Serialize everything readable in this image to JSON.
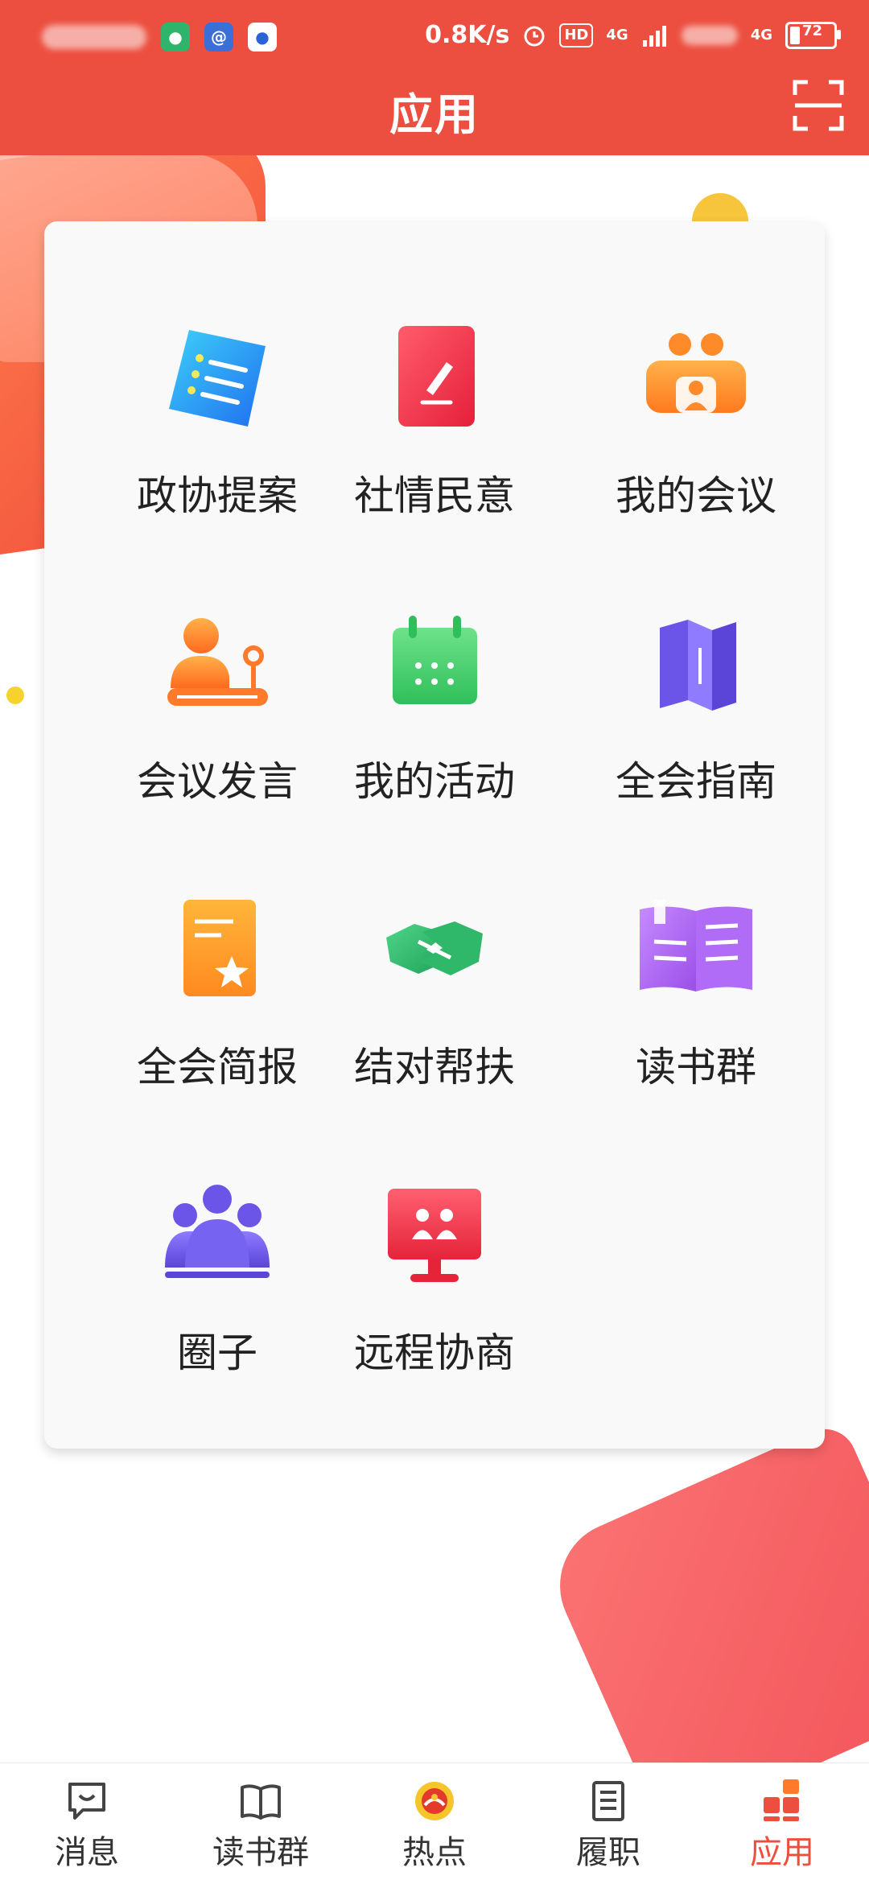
{
  "status_bar": {
    "net_speed": "0.8K/s",
    "hd_label": "HD",
    "signal1_label": "4G",
    "signal2_label": "4G",
    "battery_level": "72"
  },
  "header": {
    "title": "应用"
  },
  "apps": [
    {
      "label": "政协提案",
      "icon": "document-list-icon"
    },
    {
      "label": "社情民意",
      "icon": "edit-note-icon"
    },
    {
      "label": "我的会议",
      "icon": "meeting-icon"
    },
    {
      "label": "会议发言",
      "icon": "speaker-microphone-icon"
    },
    {
      "label": "我的活动",
      "icon": "calendar-icon"
    },
    {
      "label": "全会指南",
      "icon": "map-guide-icon"
    },
    {
      "label": "全会简报",
      "icon": "brief-star-icon"
    },
    {
      "label": "结对帮扶",
      "icon": "handshake-icon"
    },
    {
      "label": "读书群",
      "icon": "open-book-icon"
    },
    {
      "label": "圈子",
      "icon": "group-icon"
    },
    {
      "label": "远程协商",
      "icon": "remote-screen-icon"
    }
  ],
  "bottom_nav": [
    {
      "label": "消息",
      "icon": "message-icon",
      "active": false
    },
    {
      "label": "读书群",
      "icon": "book-icon",
      "active": false
    },
    {
      "label": "热点",
      "icon": "emblem-icon",
      "active": false
    },
    {
      "label": "履职",
      "icon": "document-icon",
      "active": false
    },
    {
      "label": "应用",
      "icon": "apps-grid-icon",
      "active": true
    }
  ],
  "colors": {
    "header_bg": "#ec4f3f",
    "active_tab": "#ec4f3f",
    "card_bg": "#f9f9f9"
  }
}
